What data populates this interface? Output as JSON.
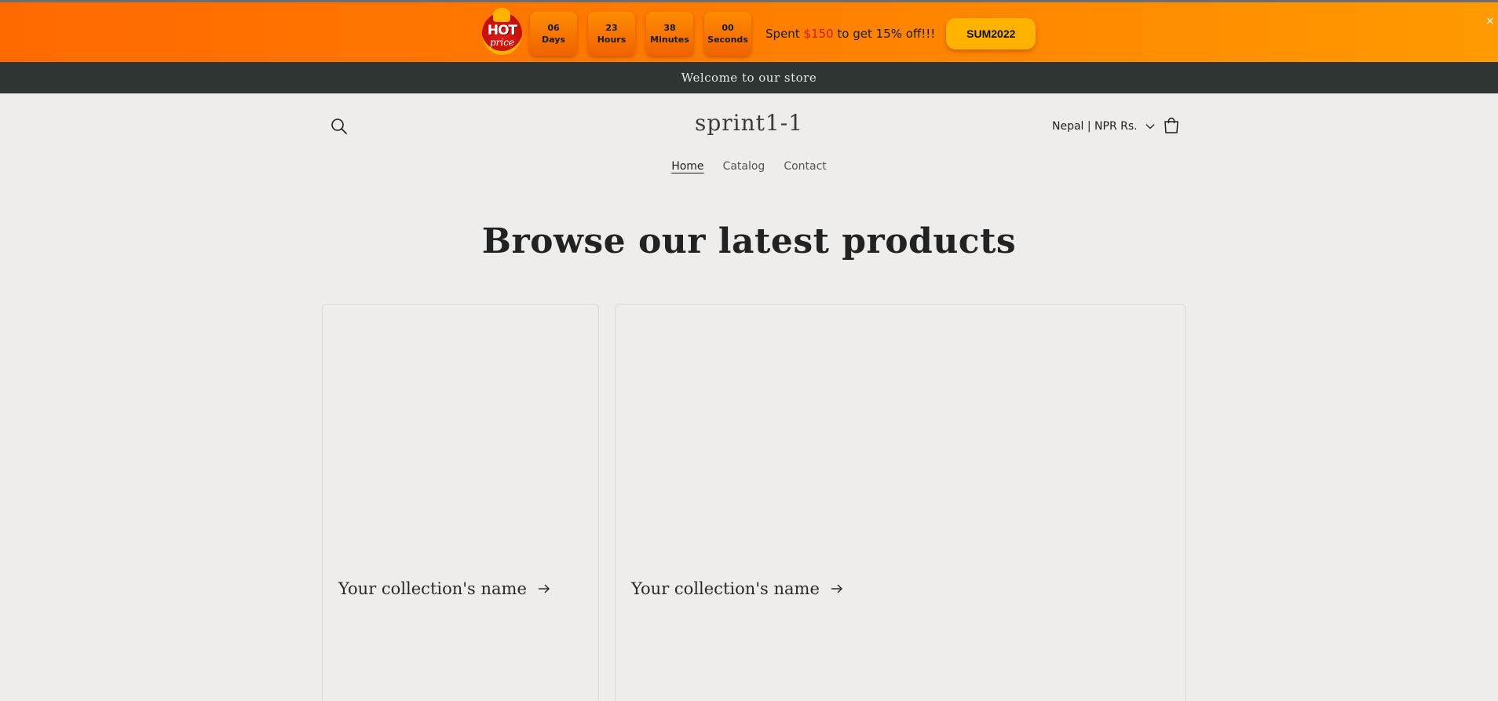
{
  "promo": {
    "logo_top": "HOT",
    "logo_bottom": "price",
    "countdown": [
      {
        "value": "06",
        "unit": "Days"
      },
      {
        "value": "23",
        "unit": "Hours"
      },
      {
        "value": "38",
        "unit": "Minutes"
      },
      {
        "value": "00",
        "unit": "Seconds"
      }
    ],
    "text_before": "Spent ",
    "amount": "$150",
    "text_after": " to get 15% off!!!",
    "coupon": "SUM2022",
    "close": "×"
  },
  "announcement": "Welcome to our store",
  "header": {
    "logo": "sprint1-1",
    "currency": "Nepal | NPR Rs."
  },
  "nav": [
    "Home",
    "Catalog",
    "Contact"
  ],
  "main": {
    "heading": "Browse our latest products",
    "collections": [
      {
        "title": "Your collection's name"
      },
      {
        "title": "Your collection's name"
      }
    ]
  },
  "colors": {
    "promo_orange": "#ff7b00",
    "coupon_yellow": "#ffb300",
    "announcement_bg": "#2e3532",
    "page_bg": "#efedeb",
    "amount_red": "#d81b1b"
  },
  "icons": [
    "hot-price-badge-icon",
    "close-icon",
    "search-icon",
    "chevron-down-icon",
    "cart-icon",
    "arrow-right-icon"
  ]
}
